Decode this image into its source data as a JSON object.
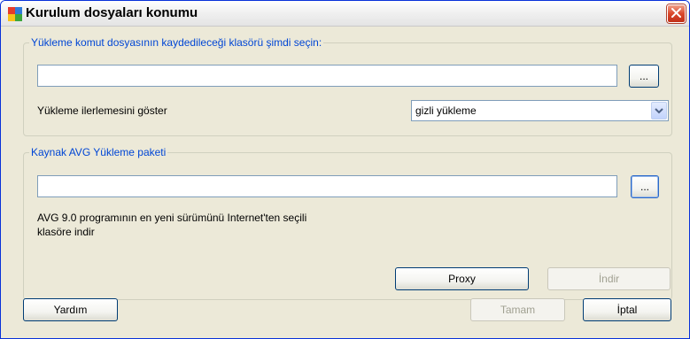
{
  "window": {
    "title": "Kurulum dosyaları konumu",
    "icon": "avg-logo-icon",
    "close_icon": "close-icon"
  },
  "install_folder_group": {
    "legend": "Yükleme komut dosyasının kaydedileceği klasörü şimdi seçin:",
    "path_value": "",
    "browse_label": "...",
    "progress_label": "Yükleme ilerlemesini göster",
    "progress_select_value": "gizli yükleme"
  },
  "source_package_group": {
    "legend": "Kaynak AVG Yükleme paketi",
    "path_value": "",
    "browse_label": "...",
    "download_info": "AVG 9.0 programının en yeni sürümünü Internet'ten seçili klasöre indir",
    "proxy_label": "Proxy",
    "download_label": "İndir"
  },
  "footer": {
    "help_label": "Yardım",
    "ok_label": "Tamam",
    "cancel_label": "İptal"
  },
  "colors": {
    "legend": "#0046d5",
    "dialog_bg": "#ece9d8",
    "close_button": "#d9482b"
  }
}
